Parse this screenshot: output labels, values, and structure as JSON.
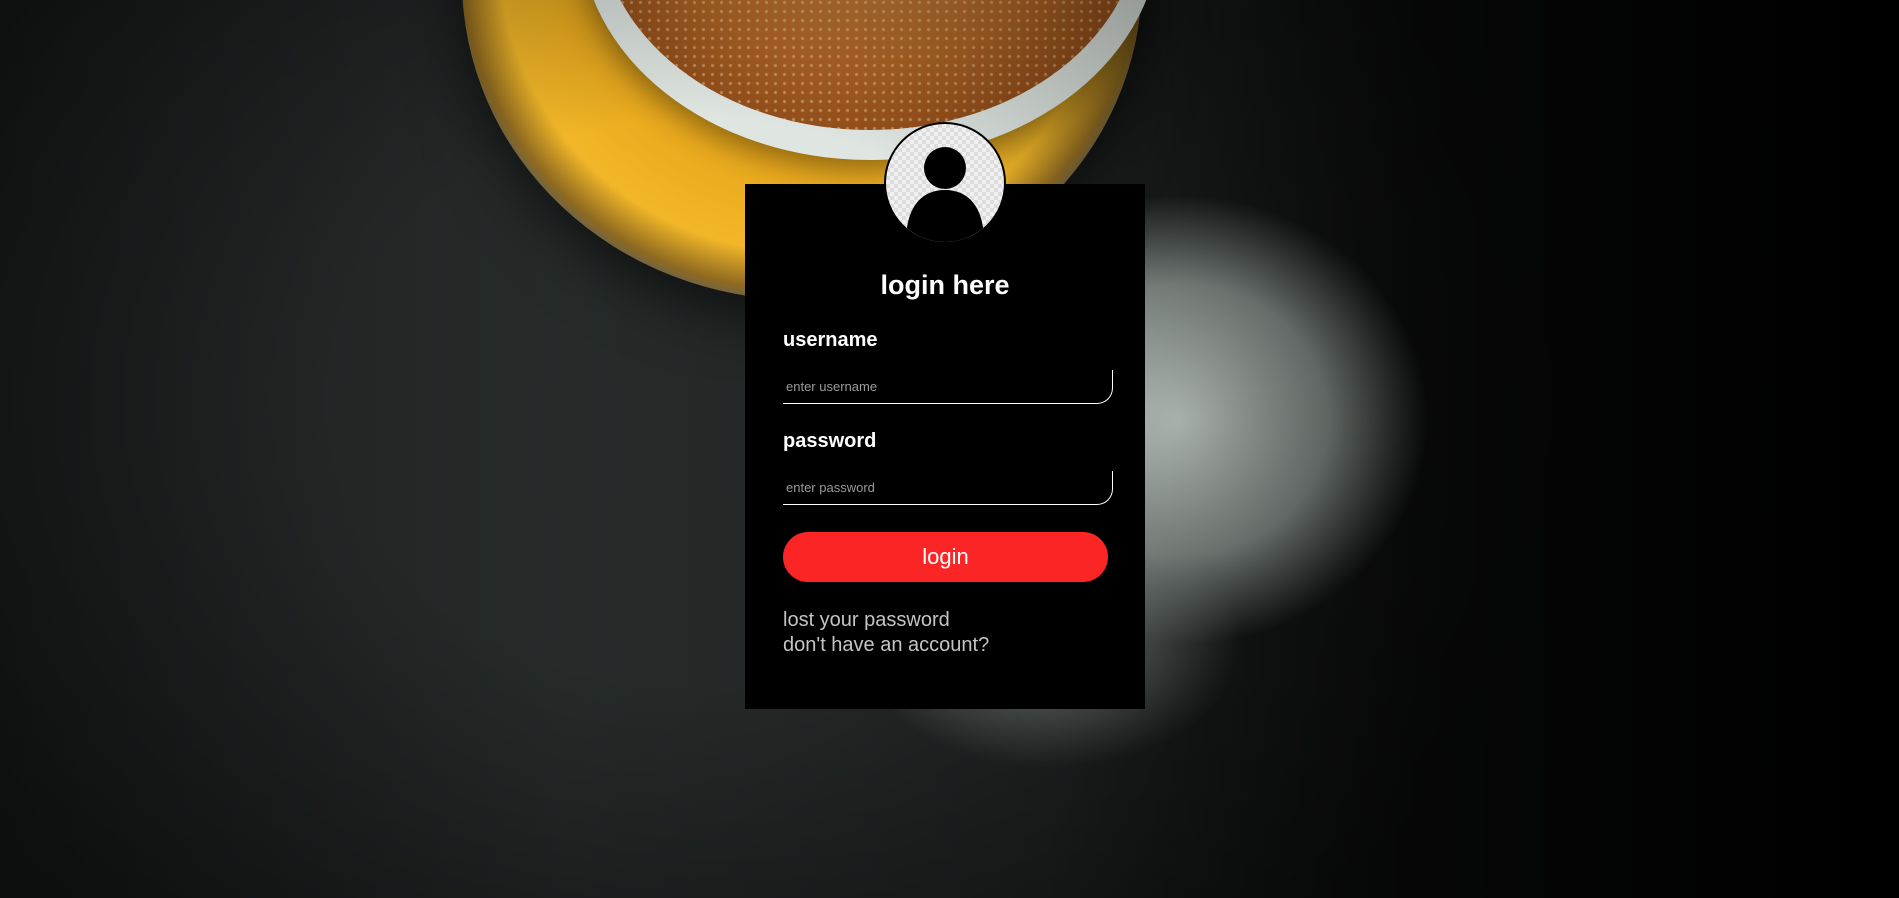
{
  "login_form": {
    "title": "login here",
    "username_label": "username",
    "username_placeholder": "enter username",
    "password_label": "password",
    "password_placeholder": "enter password",
    "submit_label": "login",
    "lost_password_link": "lost your password",
    "signup_link": "don't have an account?"
  },
  "avatar": {
    "icon": "user-silhouette-icon"
  },
  "colors": {
    "card_background": "#000000",
    "button_background": "#fb2525",
    "link_text": "#c4c4c4"
  }
}
